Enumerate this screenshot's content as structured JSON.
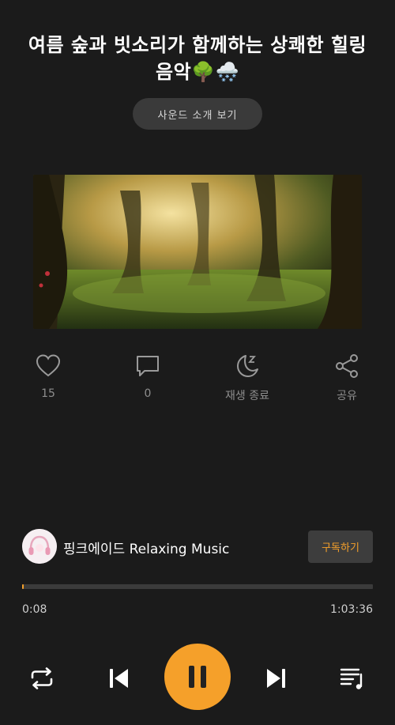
{
  "track": {
    "title": "여름 숲과 빗소리가 함께하는 상쾌한 힐링 음악🌳🌨️",
    "about_button": "사운드 소개 보기"
  },
  "actions": [
    {
      "icon": "heart-icon",
      "label": "15"
    },
    {
      "icon": "comment-icon",
      "label": "0"
    },
    {
      "icon": "moon-sleep-icon",
      "label": "재생 종료"
    },
    {
      "icon": "share-icon",
      "label": "공유"
    }
  ],
  "channel": {
    "name": "핑크에이드 Relaxing Music",
    "subscribe_label": "구독하기"
  },
  "player": {
    "current_time": "0:08",
    "total_time": "1:03:36",
    "progress_fraction": 0.002,
    "state": "playing"
  },
  "colors": {
    "accent": "#f5a02a",
    "background": "#1b1b1b"
  }
}
